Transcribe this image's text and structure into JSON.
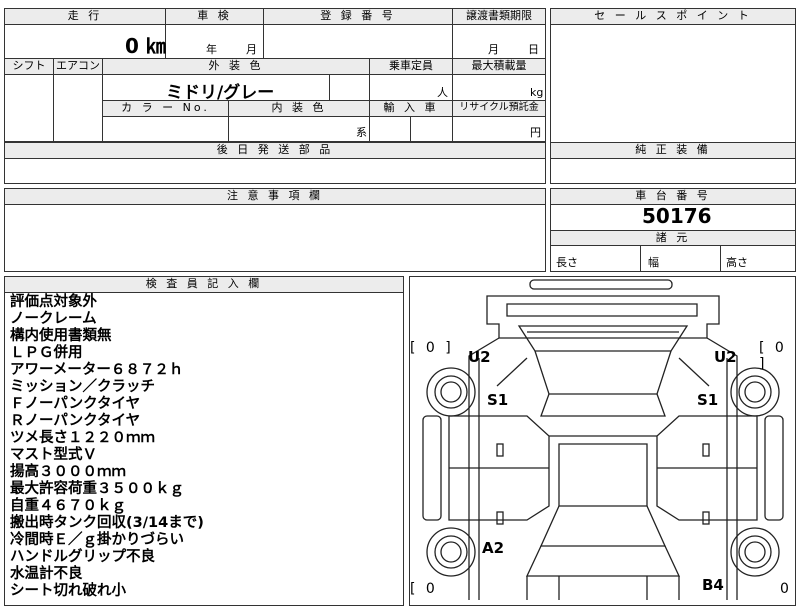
{
  "vehicle_info": {
    "mileage_header": "走 行",
    "mileage_value": "0 ㎞",
    "inspection_header": "車 検",
    "inspection_year_unit": "年",
    "inspection_month_unit": "月",
    "registration_header": "登 録 番 号",
    "transfer_deadline_header": "譲渡書類期限",
    "transfer_month_unit": "月",
    "transfer_day_unit": "日",
    "shift_header": "シフト",
    "aircon_header": "エアコン",
    "exterior_color_header": "外 装 色",
    "exterior_color_value": "ミドリ/グレー",
    "capacity_header": "乗車定員",
    "capacity_unit": "人",
    "max_load_header": "最大積載量",
    "max_load_unit": "kg",
    "color_no_header": "カ ラ ー No.",
    "interior_color_header": "内 装 色",
    "interior_color_unit": "系",
    "import_header": "輸 入 車",
    "recycle_fee_header": "リサイクル預託金",
    "recycle_fee_unit": "円",
    "later_parts_header": "後 日 発 送 部 品",
    "caution_header": "注 意 事 項 欄"
  },
  "right_panel": {
    "sales_point_header": "セ ー ル ス ポ イ ン ト",
    "genuine_equipment_header": "純 正 装 備",
    "chassis_number_header": "車 台 番 号",
    "chassis_number_value": "50176",
    "specs_header": "諸 元",
    "length_label": "長さ",
    "width_label": "幅",
    "height_label": "高さ"
  },
  "inspector": {
    "header": "検 査 員 記 入 欄",
    "notes": [
      "評価点対象外",
      "ノークレーム",
      "構内使用書類無",
      "ＬＰＧ併用",
      "アワーメーター６８７２ｈ",
      "ミッション／クラッチ",
      "Ｆノーパンクタイヤ",
      "Ｒノーパンクタイヤ",
      "ツメ長さ１２２０ｍｍ",
      "マスト型式Ｖ",
      "揚高３０００ｍｍ",
      "最大許容荷重３５００ｋｇ",
      "自重４６７０ｋｇ",
      "搬出時タンク回収(3/14まで)",
      "冷間時Ｅ／ｇ掛かりづらい",
      "ハンドルグリップ不良",
      "水温計不良",
      "シート切れ破れ小"
    ]
  },
  "diagram": {
    "bracket_top_left": "[ 0 ]",
    "bracket_top_right": "[ 0 ]",
    "bracket_bottom_left": "[ 0",
    "bracket_bottom_right": "0",
    "mark_u2_left": "U2",
    "mark_u2_right": "U2",
    "mark_s1_left": "S1",
    "mark_s1_right": "S1",
    "mark_a2": "A2",
    "mark_b4": "B4"
  }
}
